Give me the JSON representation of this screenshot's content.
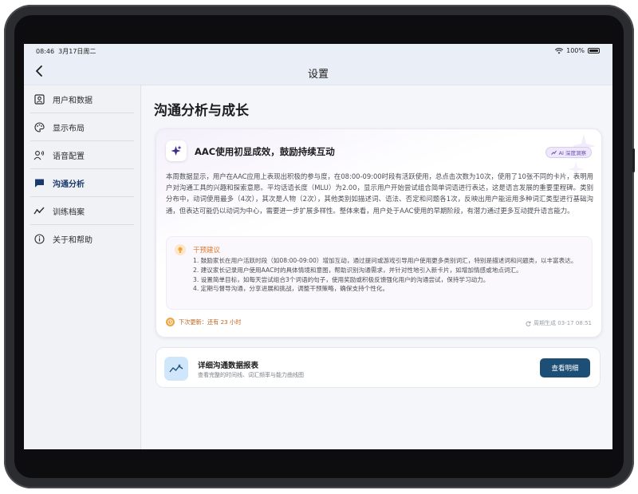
{
  "status": {
    "time": "08:46",
    "date": "3月17日周二",
    "battery": "100%"
  },
  "nav": {
    "title": "设置"
  },
  "sidebar": {
    "items": [
      {
        "label": "用户和数据",
        "icon": "user-card-icon",
        "active": false
      },
      {
        "label": "显示布局",
        "icon": "palette-icon",
        "active": false
      },
      {
        "label": "语音配置",
        "icon": "voice-user-icon",
        "active": false
      },
      {
        "label": "沟通分析",
        "icon": "chat-bubble-icon",
        "active": true
      },
      {
        "label": "训练档案",
        "icon": "trend-line-icon",
        "active": false
      },
      {
        "label": "关于和帮助",
        "icon": "info-icon",
        "active": false
      }
    ]
  },
  "main": {
    "title": "沟通分析与成长",
    "card": {
      "headline": "AAC使用初显成效，鼓励持续互动",
      "badge": "AI 深度洞察",
      "paragraph": "本周数据显示，用户在AAC应用上表现出积极的参与度，在08:00-09:00时段有活跃使用，总点击次数为10次，使用了10张不同的卡片，表明用户对沟通工具的兴趣和探索意愿。平均话语长度（MLU）为2.00，显示用户开始尝试组合简单词语进行表达，这是语言发展的重要里程碑。类别分布中，动词使用最多（4次），其次是人物（2次），其他类别如描述词、语法、否定和问题各1次，反映出用户能运用多种词汇类型进行基础沟通，但表达可能仍以动词为中心，需要进一步扩展多样性。整体来看，用户处于AAC使用的早期阶段，有潜力通过更多互动提升语言能力。",
      "advice": {
        "title": "干预建议",
        "items": [
          "1. 鼓励家长在用户活跃时段（如08:00-09:00）增加互动，通过提问或游戏引导用户使用更多类别词汇，特别是描述词和问题类，以丰富表达。",
          "2. 建议家长记录用户使用AAC时的具体情境和意图，帮助识别沟通需求，并针对性地引入新卡片，如增加情感或地点词汇。",
          "3. 设置简单目标，如每天尝试组合3个词语的句子，使用奖励或积极反馈强化用户的沟通尝试，保持学习动力。",
          "4. 定期与督导沟通，分享进展和挑战，调整干预策略，确保支持个性化。"
        ]
      },
      "next_update": "下次更新：还有 23 小时",
      "generated": "周期生成 03-17 08:51"
    },
    "report": {
      "title": "详细沟通数据报表",
      "subtitle": "查看完整的时间线、词汇频率与能力曲线图",
      "button": "查看明细"
    }
  },
  "colors": {
    "accent": "#1d4f76",
    "advice": "#e0762a",
    "badge": "#6a4bb0"
  }
}
